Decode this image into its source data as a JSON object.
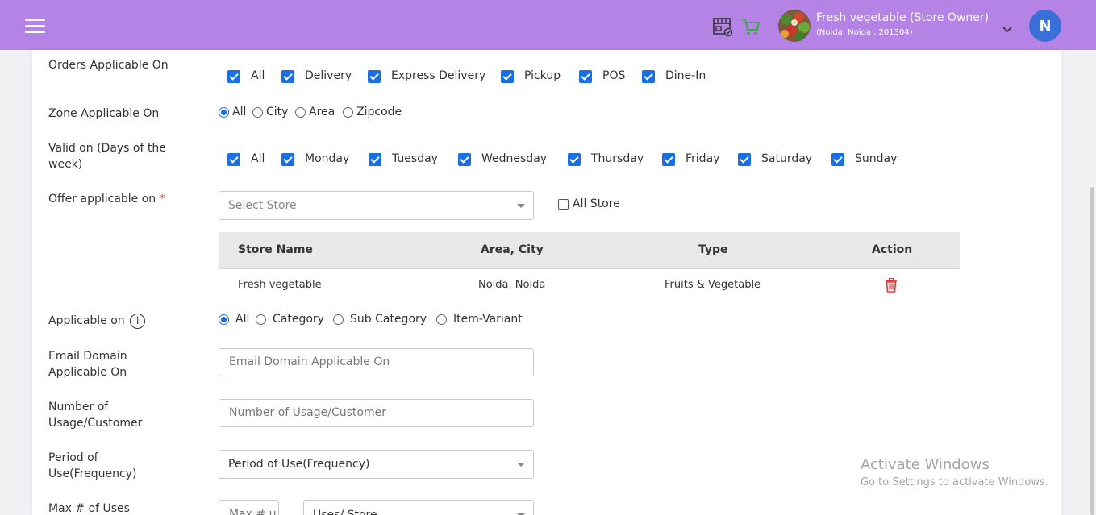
{
  "header": {
    "store_name": "Fresh vegetable (Store Owner)",
    "store_address": "(Noida, Noida , 201304)",
    "user_initial": "N",
    "accent_color": "#b583e6"
  },
  "form": {
    "orders_applicable": {
      "label": "Orders Applicable On",
      "options": [
        "All",
        "Delivery",
        "Express Delivery",
        "Pickup",
        "POS",
        "Dine-In"
      ]
    },
    "zone_applicable": {
      "label": "Zone Applicable On",
      "options": [
        "All",
        "City",
        "Area",
        "Zipcode"
      ],
      "selected": "All"
    },
    "valid_days": {
      "label_line1": "Valid on (Days of the",
      "label_line2": "week)",
      "options": [
        "All",
        "Monday",
        "Tuesday",
        "Wednesday",
        "Thursday",
        "Friday",
        "Saturday",
        "Sunday"
      ]
    },
    "offer_applicable": {
      "label": "Offer applicable on",
      "required_mark": "*",
      "select_placeholder": "Select Store",
      "all_store_label": "All Store"
    },
    "store_table": {
      "headers": [
        "Store Name",
        "Area, City",
        "Type",
        "Action"
      ],
      "rows": [
        {
          "store_name": "Fresh vegetable",
          "area_city": "Noida, Noida",
          "type": "Fruits & Vegetable"
        }
      ]
    },
    "applicable_on": {
      "label": "Applicable on",
      "info": "i",
      "options": [
        "All",
        "Category",
        "Sub Category",
        "Item-Variant"
      ],
      "selected": "All"
    },
    "email_domain": {
      "label_line1": "Email Domain",
      "label_line2": "Applicable On",
      "placeholder": "Email Domain Applicable On"
    },
    "usage_customer": {
      "label_line1": "Number of",
      "label_line2": "Usage/Customer",
      "placeholder": "Number of Usage/Customer"
    },
    "period_use": {
      "label_line1": "Period of",
      "label_line2": "Use(Frequency)",
      "selected": "Period of Use(Frequency)"
    },
    "max_uses": {
      "label": "Max # of Uses",
      "placeholder": "Max # u",
      "select_value": "Uses/ Store"
    }
  },
  "watermark": {
    "line1": "Activate Windows",
    "line2": "Go to Settings to activate Windows."
  }
}
